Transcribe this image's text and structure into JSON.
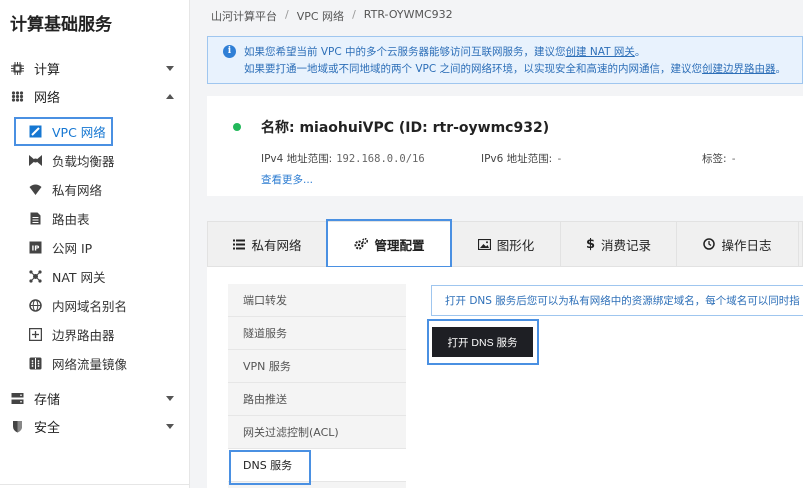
{
  "sidebar": {
    "title": "计算基础服务",
    "groups": [
      {
        "label": "计算",
        "icon": "chip-icon"
      },
      {
        "label": "网络",
        "icon": "network-icon"
      },
      {
        "label": "存储",
        "icon": "storage-icon"
      },
      {
        "label": "安全",
        "icon": "shield-icon"
      }
    ],
    "network_items": [
      {
        "label": "VPC 网络",
        "icon": "vpc-icon",
        "active": true
      },
      {
        "label": "负载均衡器",
        "icon": "load-balancer-icon"
      },
      {
        "label": "私有网络",
        "icon": "wifi-icon"
      },
      {
        "label": "路由表",
        "icon": "route-table-icon"
      },
      {
        "label": "公网 IP",
        "icon": "ip-icon"
      },
      {
        "label": "NAT 网关",
        "icon": "nat-icon"
      },
      {
        "label": "内网域名别名",
        "icon": "domain-alias-icon"
      },
      {
        "label": "边界路由器",
        "icon": "border-router-icon"
      },
      {
        "label": "网络流量镜像",
        "icon": "mirror-icon"
      }
    ]
  },
  "breadcrumb": [
    "山河计算平台",
    "VPC 网络",
    "RTR-OYWMC932"
  ],
  "notice": {
    "line1_text": "如果您希望当前 VPC 中的多个云服务器能够访问互联网服务，建议您",
    "line1_link": "创建 NAT 网关",
    "line1_end": "。",
    "line2_text": "如果要打通一地域或不同地域的两个 VPC 之间的网络环境，以实现安全和高速的内网通信，建议您",
    "line2_link": "创建边界路由器",
    "line2_end": "。"
  },
  "vpc": {
    "name": "名称: miaohuiVPC (ID: rtr-oywmc932)",
    "ipv4_label": "IPv4 地址范围:",
    "ipv4_value": "192.168.0.0/16",
    "ipv6_label": "IPv6 地址范围:",
    "ipv6_value": "-",
    "tags_label": "标签:",
    "tags_value": "-",
    "more": "查看更多..."
  },
  "tabs": [
    {
      "label": "私有网络",
      "icon": "list-icon"
    },
    {
      "label": "管理配置",
      "icon": "gears-icon",
      "active": true
    },
    {
      "label": "图形化",
      "icon": "image-icon"
    },
    {
      "label": "消费记录",
      "icon": "dollar-icon"
    },
    {
      "label": "操作日志",
      "icon": "clock-icon"
    }
  ],
  "submenu": [
    "端口转发",
    "隧道服务",
    "VPN 服务",
    "路由推送",
    "网关过滤控制(ACL)",
    "DNS 服务"
  ],
  "dns": {
    "note": "打开 DNS 服务后您可以为私有网络中的资源绑定域名，每个域名可以同时指",
    "button": "打开 DNS 服务"
  },
  "colors": {
    "accent": "#1677d2",
    "highlight": "#4a90e2",
    "status": "#22b85a",
    "button_bg": "#1e1f24"
  }
}
